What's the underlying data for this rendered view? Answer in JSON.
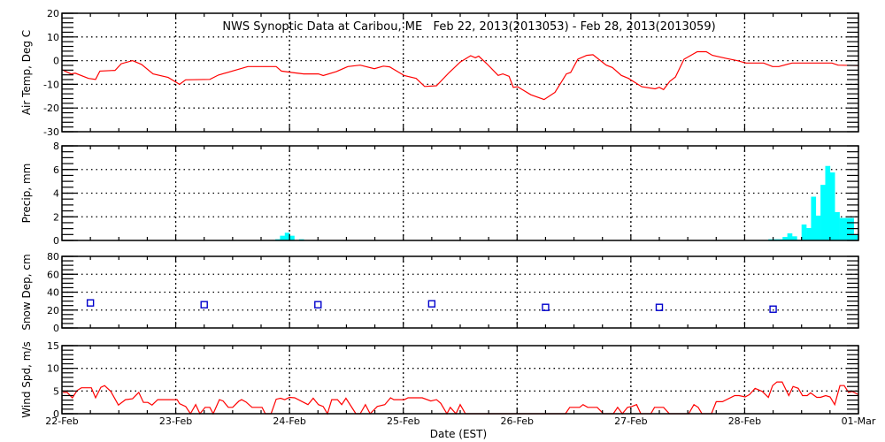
{
  "chart_data": [
    {
      "type": "line",
      "title": "NWS Synoptic Data at Caribou, ME   Feb 22, 2013(2013053) - Feb 28, 2013(2013059)",
      "ylabel": "Air Temp, Deg C",
      "ylim": [
        -30,
        20
      ],
      "yticks": [
        "20",
        "10",
        "0",
        "-10",
        "-20",
        "-30"
      ],
      "ytick_values": [
        20,
        10,
        0,
        -10,
        -20,
        -30
      ],
      "grid": [
        10,
        0,
        -10,
        -20
      ],
      "minor_step": 2,
      "color": "#ff0000",
      "x_units": "hours since 22-Feb 00:00",
      "x": [
        0,
        1.9,
        2.8,
        5.6,
        7.1,
        8.0,
        11.2,
        12.5,
        14.9,
        16.8,
        19.2,
        22.4,
        24.8,
        26.1,
        31.2,
        33.0,
        39.2,
        45.2,
        46.3,
        48.5,
        51.0,
        54.1,
        55.1,
        57.9,
        60.3,
        62.9,
        65.9,
        67.8,
        69.1,
        72.2,
        74.7,
        76.5,
        79.0,
        81.6,
        84.0,
        86.2,
        87.2,
        87.9,
        89.6,
        92.0,
        93.0,
        94.3,
        95.2,
        96.1,
        97.1,
        98.9,
        101.7,
        104.0,
        106.4,
        107.3,
        108.8,
        110.7,
        112.0,
        114.8,
        116.1,
        118.0,
        119.5,
        122.3,
        125.1,
        126.0,
        126.9,
        128.2,
        129.4,
        131.2,
        134.0,
        135.9,
        137.2,
        140.0,
        142.4,
        144.3,
        148.0,
        149.9,
        151.2,
        154.0,
        162.4,
        163.7,
        168
      ],
      "y": [
        -3.8,
        -5.6,
        -5.3,
        -7.5,
        -7.9,
        -4.4,
        -4.1,
        -1.3,
        0,
        -1.6,
        -5.6,
        -7.1,
        -10,
        -8.1,
        -7.9,
        -6.1,
        -2.5,
        -2.5,
        -4.4,
        -5.0,
        -5.6,
        -5.6,
        -6.3,
        -4.6,
        -2.5,
        -1.9,
        -3.4,
        -2.3,
        -2.6,
        -6.3,
        -7.5,
        -10.9,
        -10.6,
        -5.2,
        -0.6,
        2.1,
        1.25,
        1.9,
        -1.25,
        -6.25,
        -5.6,
        -6.6,
        -11.25,
        -11.0,
        -12.25,
        -14.4,
        -16.4,
        -13.4,
        -5.6,
        -5.0,
        0.6,
        2.25,
        2.5,
        -1.9,
        -2.9,
        -6.25,
        -7.5,
        -11.0,
        -11.9,
        -11.25,
        -12.25,
        -8.75,
        -6.9,
        0.6,
        3.75,
        3.75,
        2.25,
        1.0,
        0,
        -1.0,
        -1.0,
        -2.5,
        -2.5,
        -1.0,
        -1.0,
        -1.9,
        -2.1
      ]
    },
    {
      "type": "bar",
      "ylabel": "Precip, mm",
      "ylim": [
        0,
        8
      ],
      "yticks": [
        "8",
        "6",
        "4",
        "2",
        "0"
      ],
      "ytick_values": [
        8,
        6,
        4,
        2,
        0
      ],
      "grid": [
        2,
        4,
        6
      ],
      "minor_step": 0.5,
      "color": "#00ffff",
      "x_units": "hour bin since 22-Feb 00:00",
      "x": [
        45,
        46,
        47,
        48,
        50,
        149,
        150,
        151,
        152,
        153,
        154,
        155,
        156,
        157,
        158,
        159,
        160,
        161,
        162,
        163,
        164,
        165,
        166,
        167
      ],
      "y": [
        0.1,
        0.4,
        0.65,
        0.4,
        0.1,
        0.1,
        0.1,
        0.1,
        0.3,
        0.6,
        0.35,
        0.05,
        1.35,
        1.05,
        3.7,
        2.1,
        4.7,
        6.3,
        5.75,
        2.4,
        1.9,
        1.9,
        1.9,
        0.5
      ]
    },
    {
      "type": "scatter",
      "ylabel": "Snow Dep, cm",
      "ylim": [
        0,
        80
      ],
      "yticks": [
        "80",
        "60",
        "40",
        "20",
        "0"
      ],
      "ytick_values": [
        80,
        60,
        40,
        20,
        0
      ],
      "grid": [
        20,
        40,
        60
      ],
      "minor_step": 5,
      "color": "#0000cc",
      "x_units": "hours since 22-Feb 00:00",
      "x": [
        6,
        30,
        54,
        78,
        102,
        126,
        150
      ],
      "y": [
        28,
        26,
        26,
        27,
        23,
        23,
        21
      ]
    },
    {
      "type": "line",
      "ylabel": "Wind Spd, m/s",
      "ylim": [
        0,
        15
      ],
      "yticks": [
        "15",
        "10",
        "5",
        "0"
      ],
      "ytick_values": [
        15,
        10,
        5,
        0
      ],
      "grid": [
        5,
        10
      ],
      "minor_step": 1,
      "color": "#ff0000",
      "xlabel": "Date (EST)",
      "xtick_labels": [
        "22-Feb",
        "23-Feb",
        "24-Feb",
        "25-Feb",
        "26-Feb",
        "27-Feb",
        "28-Feb",
        "01-Mar"
      ],
      "x_units": "hours since 22-Feb 00:00",
      "x": [
        0.2,
        1.1,
        2.2,
        3.2,
        4.1,
        6.2,
        7.1,
        8.2,
        9.0,
        10.3,
        11.9,
        13.4,
        14.9,
        16.2,
        17.2,
        18.1,
        19.0,
        20.2,
        22.4,
        24.3,
        24.8,
        26.1,
        27.1,
        28.2,
        29.1,
        30.2,
        31.2,
        31.9,
        33.2,
        34.0,
        35.1,
        36.0,
        37.3,
        37.9,
        38.8,
        40.1,
        42.2,
        42.9,
        44.1,
        45.2,
        46.1,
        47.0,
        48.0,
        49.1,
        51.9,
        53.0,
        54.1,
        55.1,
        56.0,
        56.9,
        58.1,
        59.0,
        59.9,
        62.0,
        62.9,
        64.0,
        65.0,
        66.5,
        68.1,
        69.3,
        70.0,
        72.2,
        73.0,
        76.0,
        77.8,
        79.0,
        79.9,
        81.2,
        81.9,
        83.1,
        84.0,
        85.1,
        106.2,
        107.1,
        109.2,
        109.9,
        110.9,
        112.9,
        114.2,
        116.3,
        117.2,
        118.2,
        119.3,
        120.2,
        121.2,
        122.1,
        124.2,
        125.0,
        126.9,
        128.1,
        132.2,
        133.3,
        134.2,
        135.0,
        137.0,
        138.0,
        139.3,
        141.9,
        142.8,
        144.1,
        145.0,
        146.2,
        147.7,
        149.0,
        149.9,
        150.8,
        151.9,
        153.3,
        154.2,
        155.3,
        156.2,
        157.2,
        157.9,
        159.2,
        160.0,
        161.1,
        162.0,
        163.0,
        164.1,
        165.0,
        165.9,
        166.7,
        168
      ],
      "y": [
        4.7,
        4.7,
        3.5,
        5.1,
        5.7,
        5.7,
        3.5,
        5.8,
        6.2,
        4.9,
        1.9,
        3.1,
        3.3,
        4.7,
        2.5,
        2.5,
        1.9,
        3.1,
        3.1,
        3.1,
        2.2,
        1.6,
        0,
        2.0,
        0,
        1.4,
        1.4,
        0,
        3.1,
        2.8,
        1.4,
        1.4,
        2.75,
        3.1,
        2.6,
        1.4,
        1.4,
        0,
        0,
        3.2,
        3.4,
        3.1,
        3.6,
        3.5,
        2.0,
        3.4,
        2.0,
        1.6,
        0,
        3.1,
        3.1,
        2.0,
        3.4,
        0,
        0,
        2.0,
        0,
        1.6,
        2.0,
        3.5,
        3.1,
        3.1,
        3.5,
        3.5,
        2.8,
        3.1,
        2.3,
        0,
        1.4,
        0,
        2.0,
        0,
        0,
        1.4,
        1.4,
        2.0,
        1.4,
        1.4,
        0,
        0,
        1.4,
        0,
        1.4,
        1.6,
        2.0,
        0,
        0,
        1.4,
        1.4,
        0,
        0,
        2.0,
        1.4,
        0,
        0,
        2.65,
        2.65,
        4.0,
        4.0,
        3.7,
        4.2,
        5.6,
        4.9,
        3.6,
        6.2,
        7.0,
        7.0,
        4.0,
        6.0,
        5.6,
        4.0,
        4.0,
        4.6,
        3.6,
        3.6,
        4.0,
        3.7,
        2.0,
        6.2,
        6.2,
        4.7,
        4.9,
        4.2
      ]
    }
  ]
}
